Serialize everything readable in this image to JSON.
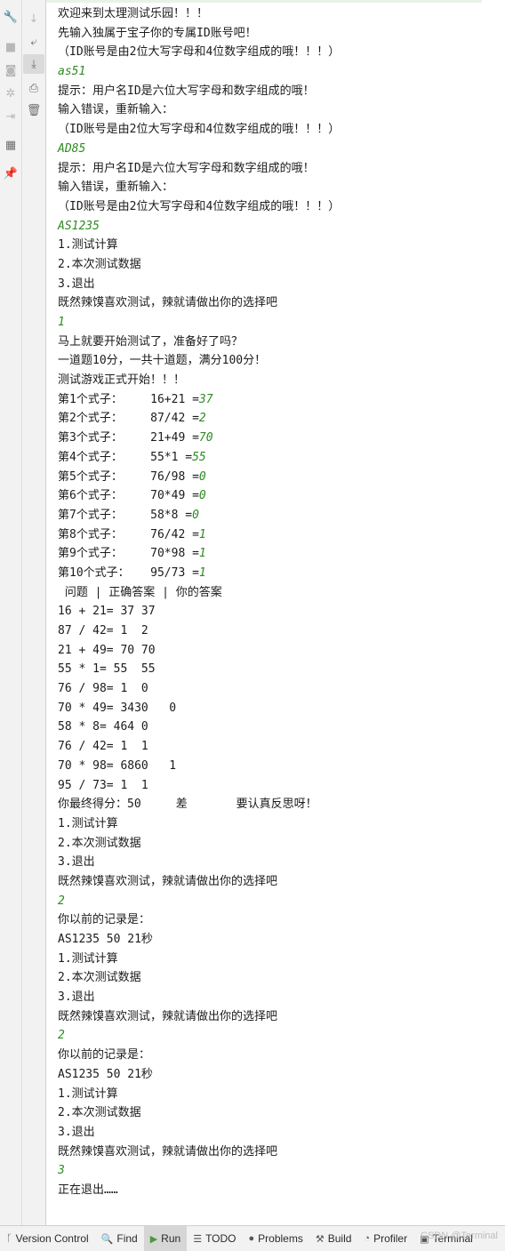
{
  "console_lines": [
    {
      "text": "欢迎来到太理测试乐园！！！",
      "kind": "output"
    },
    {
      "text": "先输入独属于宝子你的专属ID账号吧！",
      "kind": "output"
    },
    {
      "text": "（ID账号是由2位大写字母和4位数字组成的哦！！！）",
      "kind": "output"
    },
    {
      "text": "as51",
      "kind": "input"
    },
    {
      "text": "提示：用户名ID是六位大写字母和数字组成的哦！",
      "kind": "output"
    },
    {
      "text": "输入错误，重新输入：",
      "kind": "output"
    },
    {
      "text": "（ID账号是由2位大写字母和4位数字组成的哦！！！）",
      "kind": "output"
    },
    {
      "text": "AD85",
      "kind": "input"
    },
    {
      "text": "提示：用户名ID是六位大写字母和数字组成的哦！",
      "kind": "output"
    },
    {
      "text": "输入错误，重新输入：",
      "kind": "output"
    },
    {
      "text": "（ID账号是由2位大写字母和4位数字组成的哦！！！）",
      "kind": "output"
    },
    {
      "text": "AS1235",
      "kind": "input"
    },
    {
      "text": "1.测试计算",
      "kind": "output"
    },
    {
      "text": "2.本次测试数据",
      "kind": "output"
    },
    {
      "text": "3.退出",
      "kind": "output"
    },
    {
      "text": "既然辣馍喜欢测试，辣就请做出你的选择吧",
      "kind": "output"
    },
    {
      "text": "1",
      "kind": "input"
    },
    {
      "text": "马上就要开始测试了，准备好了吗？",
      "kind": "output"
    },
    {
      "text": "一道题10分，一共十道题，满分100分！",
      "kind": "output"
    },
    {
      "text": "测试游戏正式开始！！！",
      "kind": "output"
    },
    {
      "text": "第1个式子：    16+21 =",
      "answer": "37",
      "kind": "question"
    },
    {
      "text": "第2个式子：    87/42 =",
      "answer": "2",
      "kind": "question"
    },
    {
      "text": "第3个式子：    21+49 =",
      "answer": "70",
      "kind": "question"
    },
    {
      "text": "第4个式子：    55*1 =",
      "answer": "55",
      "kind": "question"
    },
    {
      "text": "第5个式子：    76/98 =",
      "answer": "0",
      "kind": "question"
    },
    {
      "text": "第6个式子：    70*49 =",
      "answer": "0",
      "kind": "question"
    },
    {
      "text": "第7个式子：    58*8 =",
      "answer": "0",
      "kind": "question"
    },
    {
      "text": "第8个式子：    76/42 =",
      "answer": "1",
      "kind": "question"
    },
    {
      "text": "第9个式子：    70*98 =",
      "answer": "1",
      "kind": "question"
    },
    {
      "text": "第10个式子：   95/73 =",
      "answer": "1",
      "kind": "question"
    },
    {
      "text": " 问题 | 正确答案 | 你的答案",
      "kind": "output"
    },
    {
      "text": "16 + 21= 37 37",
      "kind": "output"
    },
    {
      "text": "87 / 42= 1  2",
      "kind": "output"
    },
    {
      "text": "21 + 49= 70 70",
      "kind": "output"
    },
    {
      "text": "55 * 1= 55  55",
      "kind": "output"
    },
    {
      "text": "76 / 98= 1  0",
      "kind": "output"
    },
    {
      "text": "70 * 49= 3430   0",
      "kind": "output"
    },
    {
      "text": "58 * 8= 464 0",
      "kind": "output"
    },
    {
      "text": "76 / 42= 1  1",
      "kind": "output"
    },
    {
      "text": "70 * 98= 6860   1",
      "kind": "output"
    },
    {
      "text": "95 / 73= 1  1",
      "kind": "output"
    },
    {
      "text": "你最终得分：50     差       要认真反思呀！",
      "kind": "output"
    },
    {
      "text": "1.测试计算",
      "kind": "output"
    },
    {
      "text": "2.本次测试数据",
      "kind": "output"
    },
    {
      "text": "3.退出",
      "kind": "output"
    },
    {
      "text": "既然辣馍喜欢测试，辣就请做出你的选择吧",
      "kind": "output"
    },
    {
      "text": "2",
      "kind": "input"
    },
    {
      "text": "你以前的记录是：",
      "kind": "output"
    },
    {
      "text": "AS1235 50 21秒",
      "kind": "output"
    },
    {
      "text": "1.测试计算",
      "kind": "output"
    },
    {
      "text": "2.本次测试数据",
      "kind": "output"
    },
    {
      "text": "3.退出",
      "kind": "output"
    },
    {
      "text": "既然辣馍喜欢测试，辣就请做出你的选择吧",
      "kind": "output"
    },
    {
      "text": "2",
      "kind": "input"
    },
    {
      "text": "你以前的记录是：",
      "kind": "output"
    },
    {
      "text": "AS1235 50 21秒",
      "kind": "output"
    },
    {
      "text": "1.测试计算",
      "kind": "output"
    },
    {
      "text": "2.本次测试数据",
      "kind": "output"
    },
    {
      "text": "3.退出",
      "kind": "output"
    },
    {
      "text": "既然辣馍喜欢测试，辣就请做出你的选择吧",
      "kind": "output"
    },
    {
      "text": "3",
      "kind": "input"
    },
    {
      "text": "正在退出……",
      "kind": "output"
    }
  ],
  "status_bar": {
    "version_control": "Version Control",
    "find": "Find",
    "run": "Run",
    "todo": "TODO",
    "problems": "Problems",
    "build": "Build",
    "profiler": "Profiler",
    "terminal": "Terminal"
  },
  "watermark": "CSDN @Terminal",
  "colors": {
    "input_text": "#2e8b22",
    "output_text": "#1b1b1b",
    "toolbar_bg": "#f2f2f2"
  }
}
